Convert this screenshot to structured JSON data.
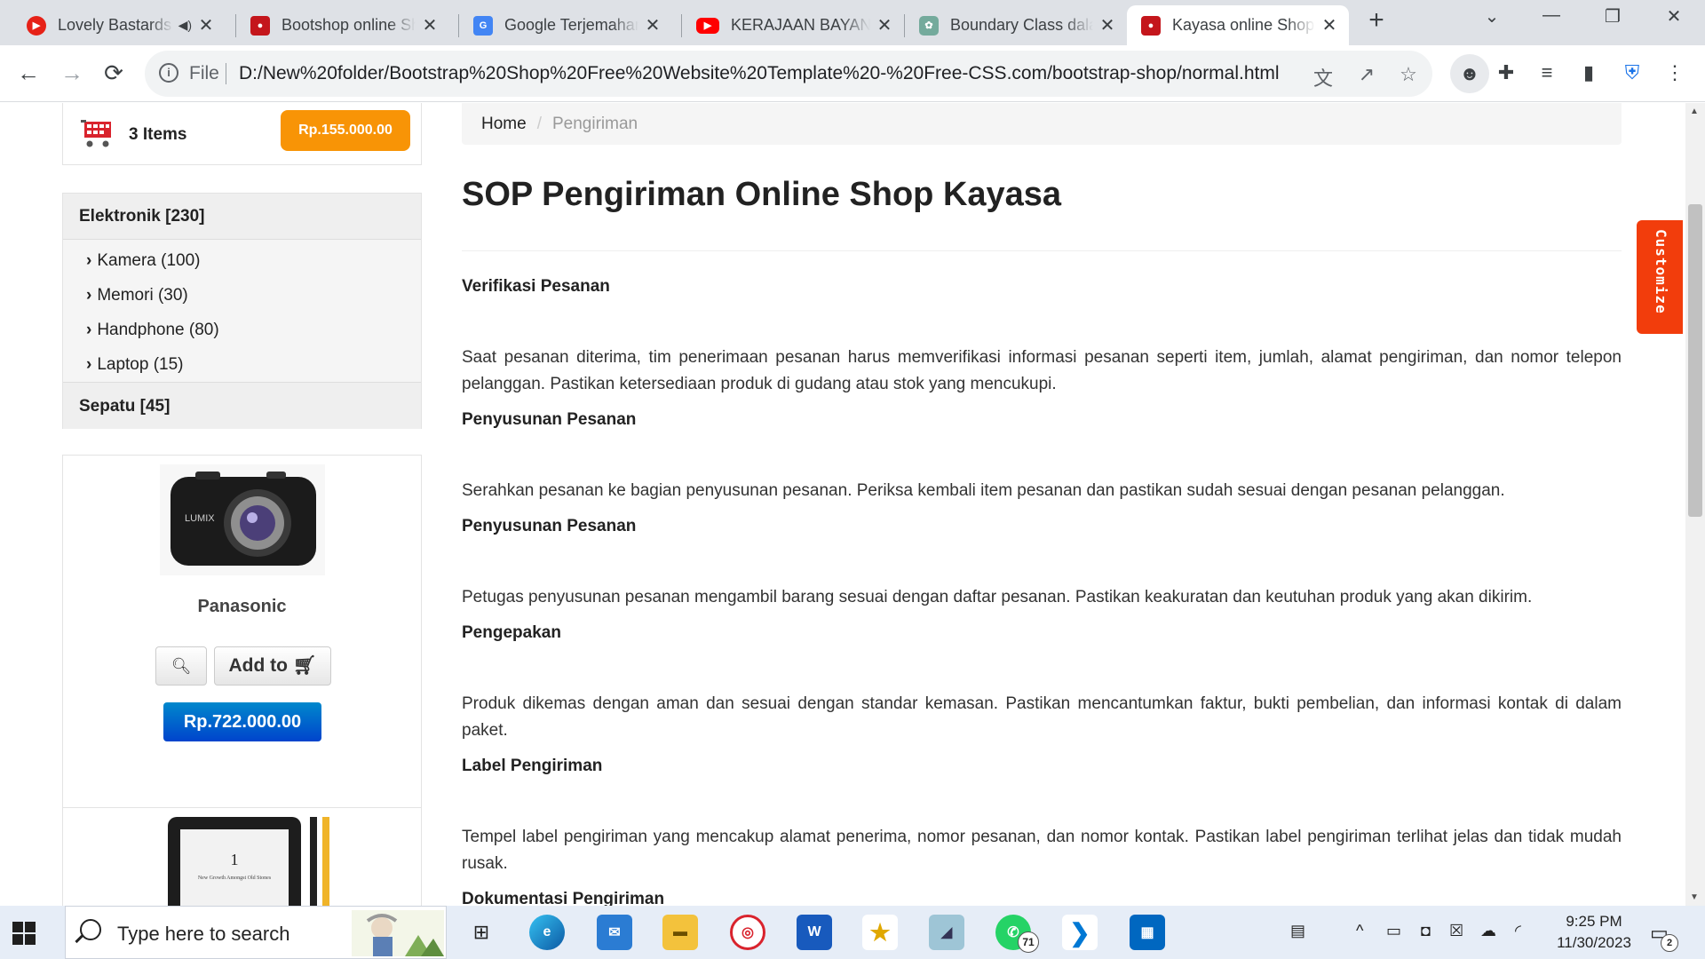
{
  "browser": {
    "tabs": [
      {
        "title": "Lovely Bastards",
        "favicon_color": "#e62117",
        "audio": true,
        "active": false
      },
      {
        "title": "Bootshop online Shopping cart",
        "favicon_color": "#c4161c",
        "audio": false,
        "active": false
      },
      {
        "title": "Google Terjemahan",
        "favicon_color": "#4285f4",
        "audio": false,
        "active": false
      },
      {
        "title": "KERAJAAN BAYANGAN",
        "favicon_color": "#ff0000",
        "audio": false,
        "active": false
      },
      {
        "title": "Boundary Class dalam UML",
        "favicon_color": "#74aa9c",
        "audio": false,
        "active": false
      },
      {
        "title": "Kayasa online Shopping",
        "favicon_color": "#c4161c",
        "audio": false,
        "active": true
      }
    ],
    "address": {
      "scheme": "File",
      "url": "D:/New%20folder/Bootstrap%20Shop%20Free%20Website%20Template%20-%20Free-CSS.com/bootstrap-shop/normal.html"
    }
  },
  "sidebar": {
    "cart": {
      "items_label": "3 Items",
      "total": "Rp.155.000.00"
    },
    "categories": {
      "group1": "Elektronik [230]",
      "items": [
        {
          "label": "Kamera (100)"
        },
        {
          "label": "Memori (30)"
        },
        {
          "label": "Handphone (80)"
        },
        {
          "label": "Laptop (15)"
        }
      ],
      "group2": "Sepatu [45]"
    },
    "product": {
      "name": "Panasonic",
      "add_label": "Add to",
      "price": "Rp.722.000.00",
      "image_brand": "LUMIX"
    },
    "product2": {
      "book_number": "1",
      "book_title": "New Growth Amongst Old Stones"
    }
  },
  "main": {
    "breadcrumb": {
      "home": "Home",
      "separator": "/",
      "current": "Pengiriman"
    },
    "title": "SOP Pengiriman Online Shop Kayasa",
    "sections": [
      {
        "heading": "Verifikasi Pesanan",
        "body": "Saat pesanan diterima, tim penerimaan pesanan harus memverifikasi informasi pesanan seperti item, jumlah, alamat pengiriman, dan nomor telepon pelanggan. Pastikan ketersediaan produk di gudang atau stok yang mencukupi."
      },
      {
        "heading": "Penyusunan Pesanan",
        "body": "Serahkan pesanan ke bagian penyusunan pesanan. Periksa kembali item pesanan dan pastikan sudah sesuai dengan pesanan pelanggan."
      },
      {
        "heading": "Penyusunan Pesanan",
        "body": "Petugas penyusunan pesanan mengambil barang sesuai dengan daftar pesanan. Pastikan keakuratan dan keutuhan produk yang akan dikirim."
      },
      {
        "heading": "Pengepakan",
        "body": "Produk dikemas dengan aman dan sesuai dengan standar kemasan. Pastikan mencantumkan faktur, bukti pembelian, dan informasi kontak di dalam paket."
      },
      {
        "heading": "Label Pengiriman",
        "body": "Tempel label pengiriman yang mencakup alamat penerima, nomor pesanan, dan nomor kontak. Pastikan label pengiriman terlihat jelas dan tidak mudah rusak."
      },
      {
        "heading": "Dokumentasi Pengiriman",
        "body": ""
      }
    ],
    "customize_label": "Customize"
  },
  "taskbar": {
    "search_placeholder": "Type here to search",
    "whatsapp_badge": "71",
    "notification_badge": "2",
    "time": "9:25 PM",
    "date": "11/30/2023"
  },
  "colors": {
    "accent_orange": "#f89406",
    "price_blue": "#0044cc",
    "customize_red": "#f23d0c"
  }
}
